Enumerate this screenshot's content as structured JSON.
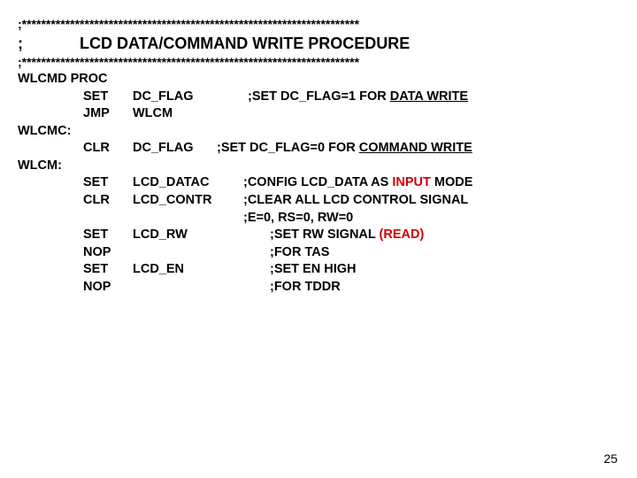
{
  "stars_top": ";**********************************************************************",
  "title_prefix": ";",
  "title_text": "LCD DATA/COMMAND WRITE PROCEDURE",
  "stars_bot": ";**********************************************************************",
  "l_wlcmd": "WLCMD PROC",
  "mn_set": "SET",
  "mn_jmp": "JMP",
  "mn_clr": "CLR",
  "mn_nop": "NOP",
  "op_dcflag": "DC_FLAG",
  "op_wlcm": "WLCM",
  "op_lcd_datac": "LCD_DATAC",
  "op_lcd_contr": "LCD_CONTR",
  "op_lcd_rw": "LCD_RW",
  "op_lcd_en": "LCD_EN",
  "l_wlcmc": "WLCMC:",
  "l_wlcm": "WLCM:",
  "c_dataw_pre": ";SET DC_FLAG=1 FOR ",
  "c_dataw_key": "DATA WRITE",
  "c_cmdw_pre": ";SET DC_FLAG=0 FOR ",
  "c_cmdw_key": "COMMAND WRITE",
  "c_cfg_pre": ";CONFIG LCD_DATA AS ",
  "c_cfg_key": "INPUT",
  "c_cfg_post": " MODE",
  "c_clr": ";CLEAR ALL LCD CONTROL SIGNAL",
  "c_ers": ";E=0, RS=0, RW=0",
  "c_rw_pre": ";SET RW SIGNAL ",
  "c_rw_key": "(READ)",
  "c_tas": ";FOR TAS",
  "c_enhigh": ";SET EN HIGH",
  "c_tddr": ";FOR TDDR",
  "pagenum": "25"
}
